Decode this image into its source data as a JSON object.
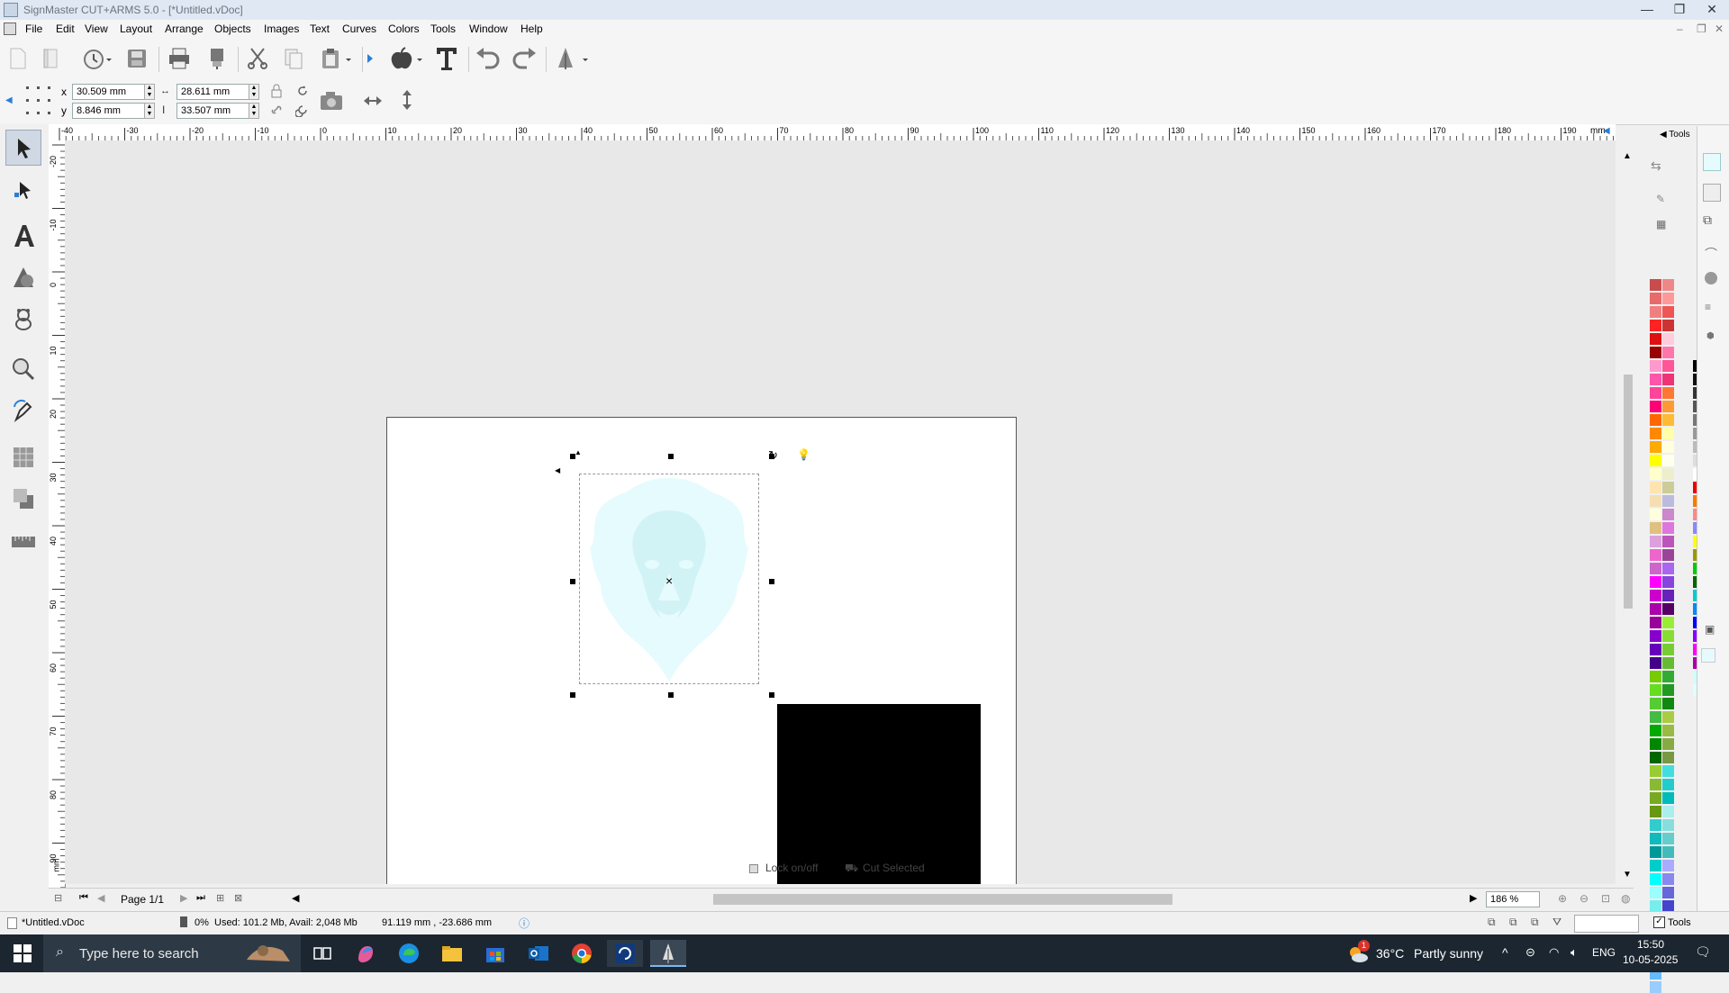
{
  "window": {
    "title": "SignMaster CUT+ARMS 5.0 - [*Untitled.vDoc]",
    "min_glyph": "—",
    "restore_glyph": "❐",
    "close_glyph": "✕"
  },
  "menu": {
    "items": [
      "File",
      "Edit",
      "View",
      "Layout",
      "Arrange",
      "Objects",
      "Images",
      "Text",
      "Curves",
      "Colors",
      "Tools",
      "Window",
      "Help"
    ]
  },
  "properties": {
    "x_label": "x",
    "y_label": "y",
    "x_value": "30.509 mm",
    "y_value": "8.846 mm",
    "width_value": "28.611 mm",
    "height_value": "33.507 mm"
  },
  "ruler": {
    "h_ticks": [
      "-40",
      "-30",
      "-20",
      "-10",
      "0",
      "10",
      "20",
      "30",
      "40",
      "50",
      "60",
      "70",
      "80",
      "90",
      "100",
      "110",
      "120",
      "130",
      "140",
      "150",
      "160",
      "170",
      "180",
      "190"
    ],
    "h_unit": "mm",
    "v_ticks": [
      "-20",
      "-10",
      "0",
      "10",
      "20",
      "30",
      "40",
      "50",
      "60",
      "70",
      "80",
      "90"
    ],
    "v_unit": "mm"
  },
  "canvas": {
    "lock_label": "Lock on/off",
    "cut_selected_label": "Cut Selected",
    "object_fill": "#000000",
    "image_tint": "#e6fbfd"
  },
  "nav": {
    "page_label": "Page 1/1",
    "zoom_value": "186 %"
  },
  "status": {
    "doc_name": "*Untitled.vDoc",
    "progress": "0%",
    "memory": "Used: 101.2 Mb, Avail: 2,048 Mb",
    "cursor": "91.119 mm , -23.686 mm",
    "tools_label": "Tools"
  },
  "docker": {
    "title": "Tools"
  },
  "taskbar": {
    "search_placeholder": "Type here to search",
    "weather_temp": "36°C",
    "weather_text": "Partly sunny",
    "weather_badge": "1",
    "lang": "ENG",
    "time": "15:50",
    "date": "10-05-2025"
  },
  "palette": {
    "left_column": [
      "#c94c4c",
      "#e86a6a",
      "#f08080",
      "#f22",
      "#d11",
      "#900",
      "#f9c",
      "#f5a",
      "#f49",
      "#f07",
      "#f60",
      "#f80",
      "#fa0",
      "#ff0",
      "#ffc",
      "#ffe4b0",
      "#f5deb3",
      "#ffd",
      "#e0c080",
      "#dda0dd",
      "#e6c",
      "#c6c",
      "#f0f",
      "#c0c",
      "#a0a",
      "#909",
      "#80c",
      "#60b",
      "#408",
      "#7c0",
      "#6d2",
      "#5c3",
      "#4b4",
      "#0a0",
      "#080",
      "#060",
      "#9c3",
      "#8b3",
      "#7a2",
      "#691",
      "#3cc",
      "#1bb",
      "#099",
      "#0cc",
      "#0ff",
      "#9ff",
      "#7ee",
      "#5dd",
      "#3cc",
      "#08f",
      "#4af",
      "#6bf",
      "#9cf"
    ],
    "right_column": [
      "#e88",
      "#f99",
      "#e55",
      "#c33",
      "#fcd",
      "#f7a",
      "#f59",
      "#e37",
      "#f73",
      "#f93",
      "#fb3",
      "#ffa",
      "#ffd",
      "#ffe",
      "#eec",
      "#cc9",
      "#bbd",
      "#c8c",
      "#d7d",
      "#b5b",
      "#949",
      "#a6e",
      "#84d",
      "#62b",
      "#506",
      "#9e3",
      "#8d3",
      "#7c3",
      "#6b3",
      "#3a3",
      "#292",
      "#181",
      "#ac4",
      "#9b4",
      "#8a4",
      "#794",
      "#4dd",
      "#2cc",
      "#0bb",
      "#aee",
      "#8dd",
      "#6cc",
      "#4bb",
      "#aaf",
      "#88e",
      "#66d",
      "#44c",
      "#9df",
      "#7cf",
      "#5bf",
      "#39f"
    ],
    "gray_column": [
      "#000",
      "#111",
      "#333",
      "#555",
      "#777",
      "#999",
      "#bbb",
      "#ddd",
      "#fff",
      "#e00",
      "#f70",
      "#f88",
      "#88f",
      "#ff0",
      "#990",
      "#0c0",
      "#060",
      "#0cc",
      "#08f",
      "#00f",
      "#80f",
      "#f0f",
      "#a0a",
      "#cff",
      "#dff"
    ]
  }
}
